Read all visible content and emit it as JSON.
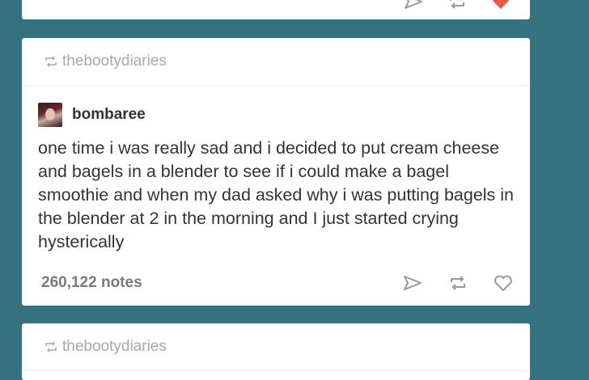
{
  "posts": [
    {
      "reblogged_from": "thebootydiaries",
      "author": "bombaree",
      "body": "one time i was really sad and i decided to put cream cheese and bagels in a blender to see if i could make a bagel smoothie and when my dad asked why i was putting bagels in the blender at 2 in the morning and I just started crying hysterically",
      "notes": "260,122 notes"
    },
    {
      "reblogged_from": "thebootydiaries"
    }
  ],
  "icons": {
    "reblog_header": "reblog-icon",
    "share": "send-icon",
    "reblog": "reblog-icon",
    "like": "heart-icon"
  },
  "colors": {
    "background": "#36717f",
    "card": "#ffffff",
    "like_active": "#e8584a"
  }
}
